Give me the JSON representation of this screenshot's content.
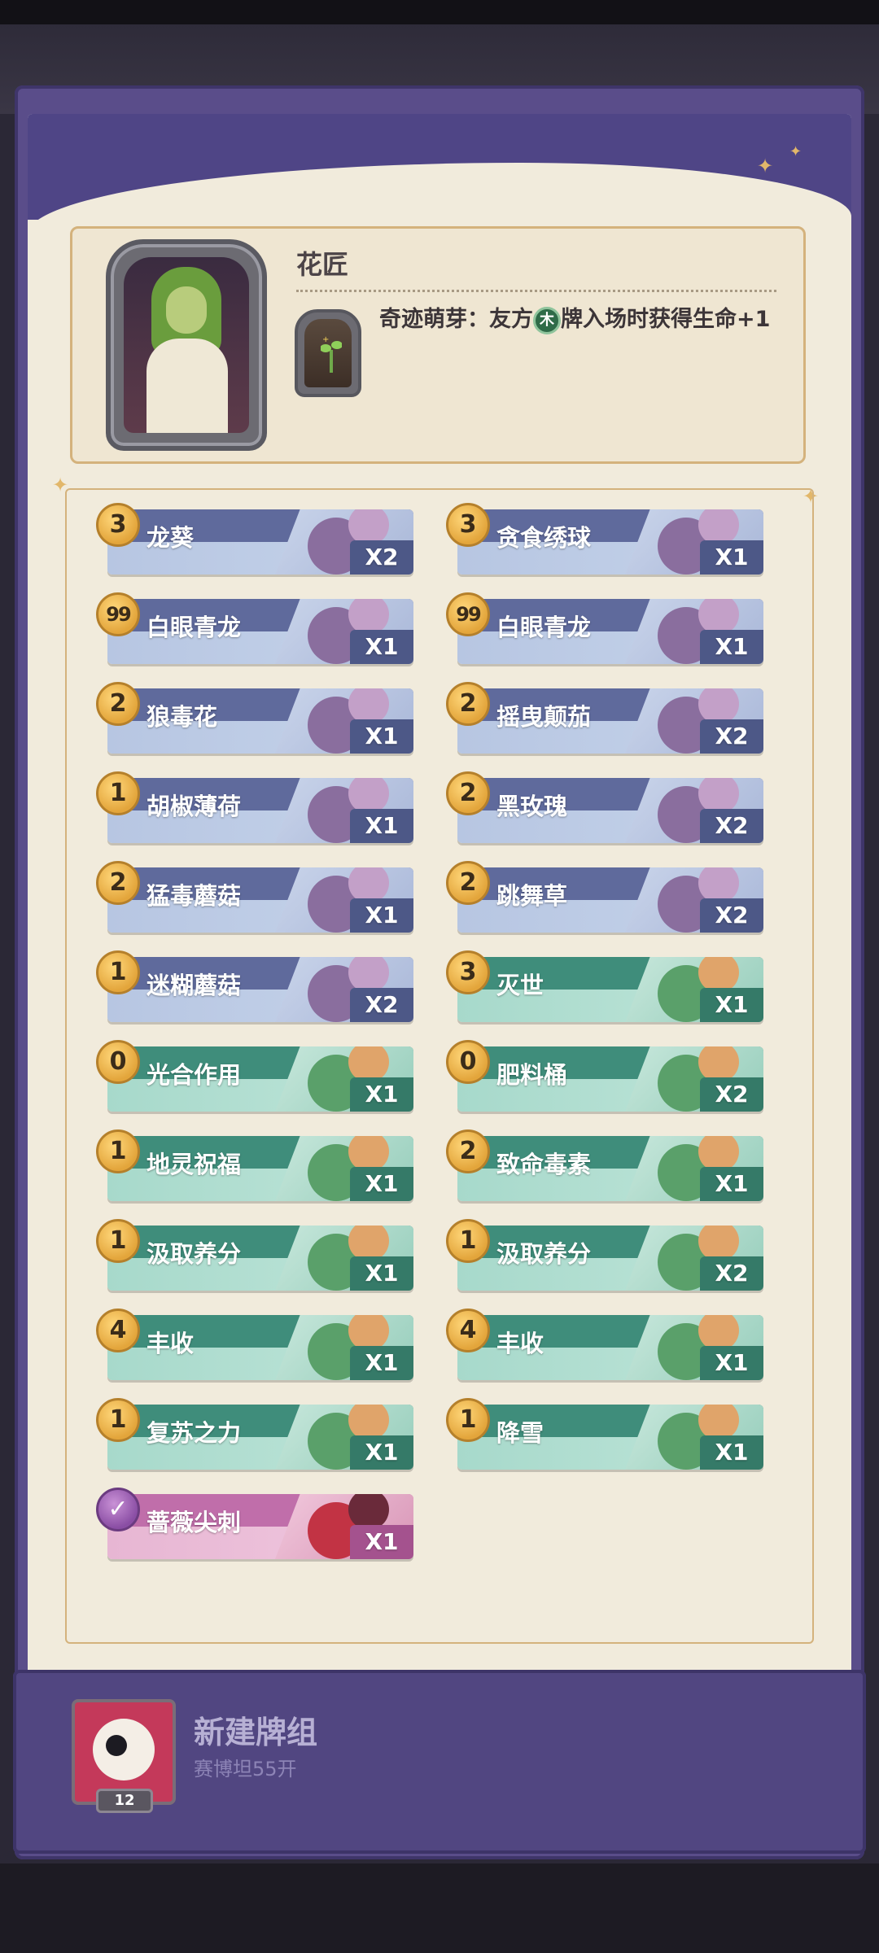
{
  "hero": {
    "name": "花匠",
    "skill_text_prefix": "奇迹萌芽：友方",
    "skill_badge": "木",
    "skill_text_suffix": "牌入场时获得生命+1"
  },
  "cards_left": [
    {
      "cost": "3",
      "name": "龙葵",
      "qty": "X2",
      "style": "blue"
    },
    {
      "cost": "99",
      "name": "白眼青龙",
      "qty": "X1",
      "style": "blue"
    },
    {
      "cost": "2",
      "name": "狼毒花",
      "qty": "X1",
      "style": "blue"
    },
    {
      "cost": "1",
      "name": "胡椒薄荷",
      "qty": "X1",
      "style": "blue"
    },
    {
      "cost": "2",
      "name": "猛毒蘑菇",
      "qty": "X1",
      "style": "blue"
    },
    {
      "cost": "1",
      "name": "迷糊蘑菇",
      "qty": "X2",
      "style": "blue"
    },
    {
      "cost": "0",
      "name": "光合作用",
      "qty": "X1",
      "style": "teal"
    },
    {
      "cost": "1",
      "name": "地灵祝福",
      "qty": "X1",
      "style": "teal"
    },
    {
      "cost": "1",
      "name": "汲取养分",
      "qty": "X1",
      "style": "teal"
    },
    {
      "cost": "4",
      "name": "丰收",
      "qty": "X1",
      "style": "teal"
    },
    {
      "cost": "1",
      "name": "复苏之力",
      "qty": "X1",
      "style": "teal"
    },
    {
      "cost": "✓",
      "name": "蔷薇尖刺",
      "qty": "X1",
      "style": "pink"
    }
  ],
  "cards_right": [
    {
      "cost": "3",
      "name": "贪食绣球",
      "qty": "X1",
      "style": "blue"
    },
    {
      "cost": "99",
      "name": "白眼青龙",
      "qty": "X1",
      "style": "blue"
    },
    {
      "cost": "2",
      "name": "摇曳颠茄",
      "qty": "X2",
      "style": "blue"
    },
    {
      "cost": "2",
      "name": "黑玫瑰",
      "qty": "X2",
      "style": "blue"
    },
    {
      "cost": "2",
      "name": "跳舞草",
      "qty": "X2",
      "style": "blue"
    },
    {
      "cost": "3",
      "name": "灭世",
      "qty": "X1",
      "style": "teal"
    },
    {
      "cost": "0",
      "name": "肥料桶",
      "qty": "X2",
      "style": "teal"
    },
    {
      "cost": "2",
      "name": "致命毒素",
      "qty": "X1",
      "style": "teal"
    },
    {
      "cost": "1",
      "name": "汲取养分",
      "qty": "X2",
      "style": "teal"
    },
    {
      "cost": "4",
      "name": "丰收",
      "qty": "X1",
      "style": "teal"
    },
    {
      "cost": "1",
      "name": "降雪",
      "qty": "X1",
      "style": "teal"
    }
  ],
  "deck": {
    "title": "新建牌组",
    "subtitle": "赛博坦55开",
    "level": "12"
  },
  "colors": {
    "frame_purple": "#5a4d8a",
    "parchment": "#f1ebdc",
    "gold": "#e3a53b",
    "card_blue": "#5f6a9c",
    "card_teal": "#3f8d7b",
    "card_pink": "#c06eaa"
  }
}
